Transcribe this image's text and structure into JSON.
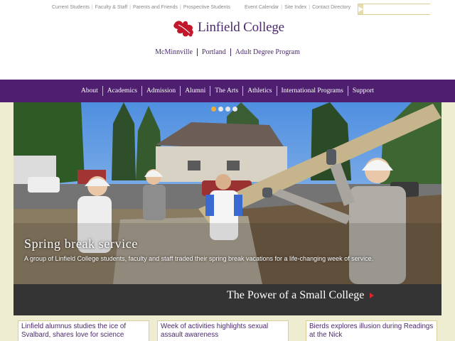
{
  "utility_left": [
    "Current Students",
    "Faculty & Staff",
    "Parents and Friends",
    "Prospective Students"
  ],
  "utility_right": [
    "Event Calendar",
    "Site Index",
    "Contact Directory"
  ],
  "search": {
    "placeholder": ""
  },
  "logo": {
    "text": "Linfield College",
    "color": "#4b2a6c",
    "leaf_color": "#c2182b"
  },
  "campus_links": [
    "McMinnville",
    "Portland",
    "Adult Degree Program"
  ],
  "main_nav": [
    "About",
    "Academics",
    "Admission",
    "Alumni",
    "The Arts",
    "Athletics",
    "International Programs",
    "Support"
  ],
  "hero": {
    "title": "Spring break service",
    "text": "A group of Linfield College students, faculty and staff traded their spring break vacations for a life-changing week of service.",
    "slide_count": 4,
    "active_slide": 1
  },
  "tagline": "The Power of a Small College",
  "news": [
    "Linfield alumnus studies the ice of Svalbard, shares love for science",
    "Week of activities highlights sexual assault awareness",
    "Bierds explores illusion during Readings at the Nick"
  ],
  "colors": {
    "nav_bg": "#4d1f6e",
    "accent": "#d9282f",
    "page_bg": "#eeedd2",
    "dot_active": "#f2ab34"
  }
}
